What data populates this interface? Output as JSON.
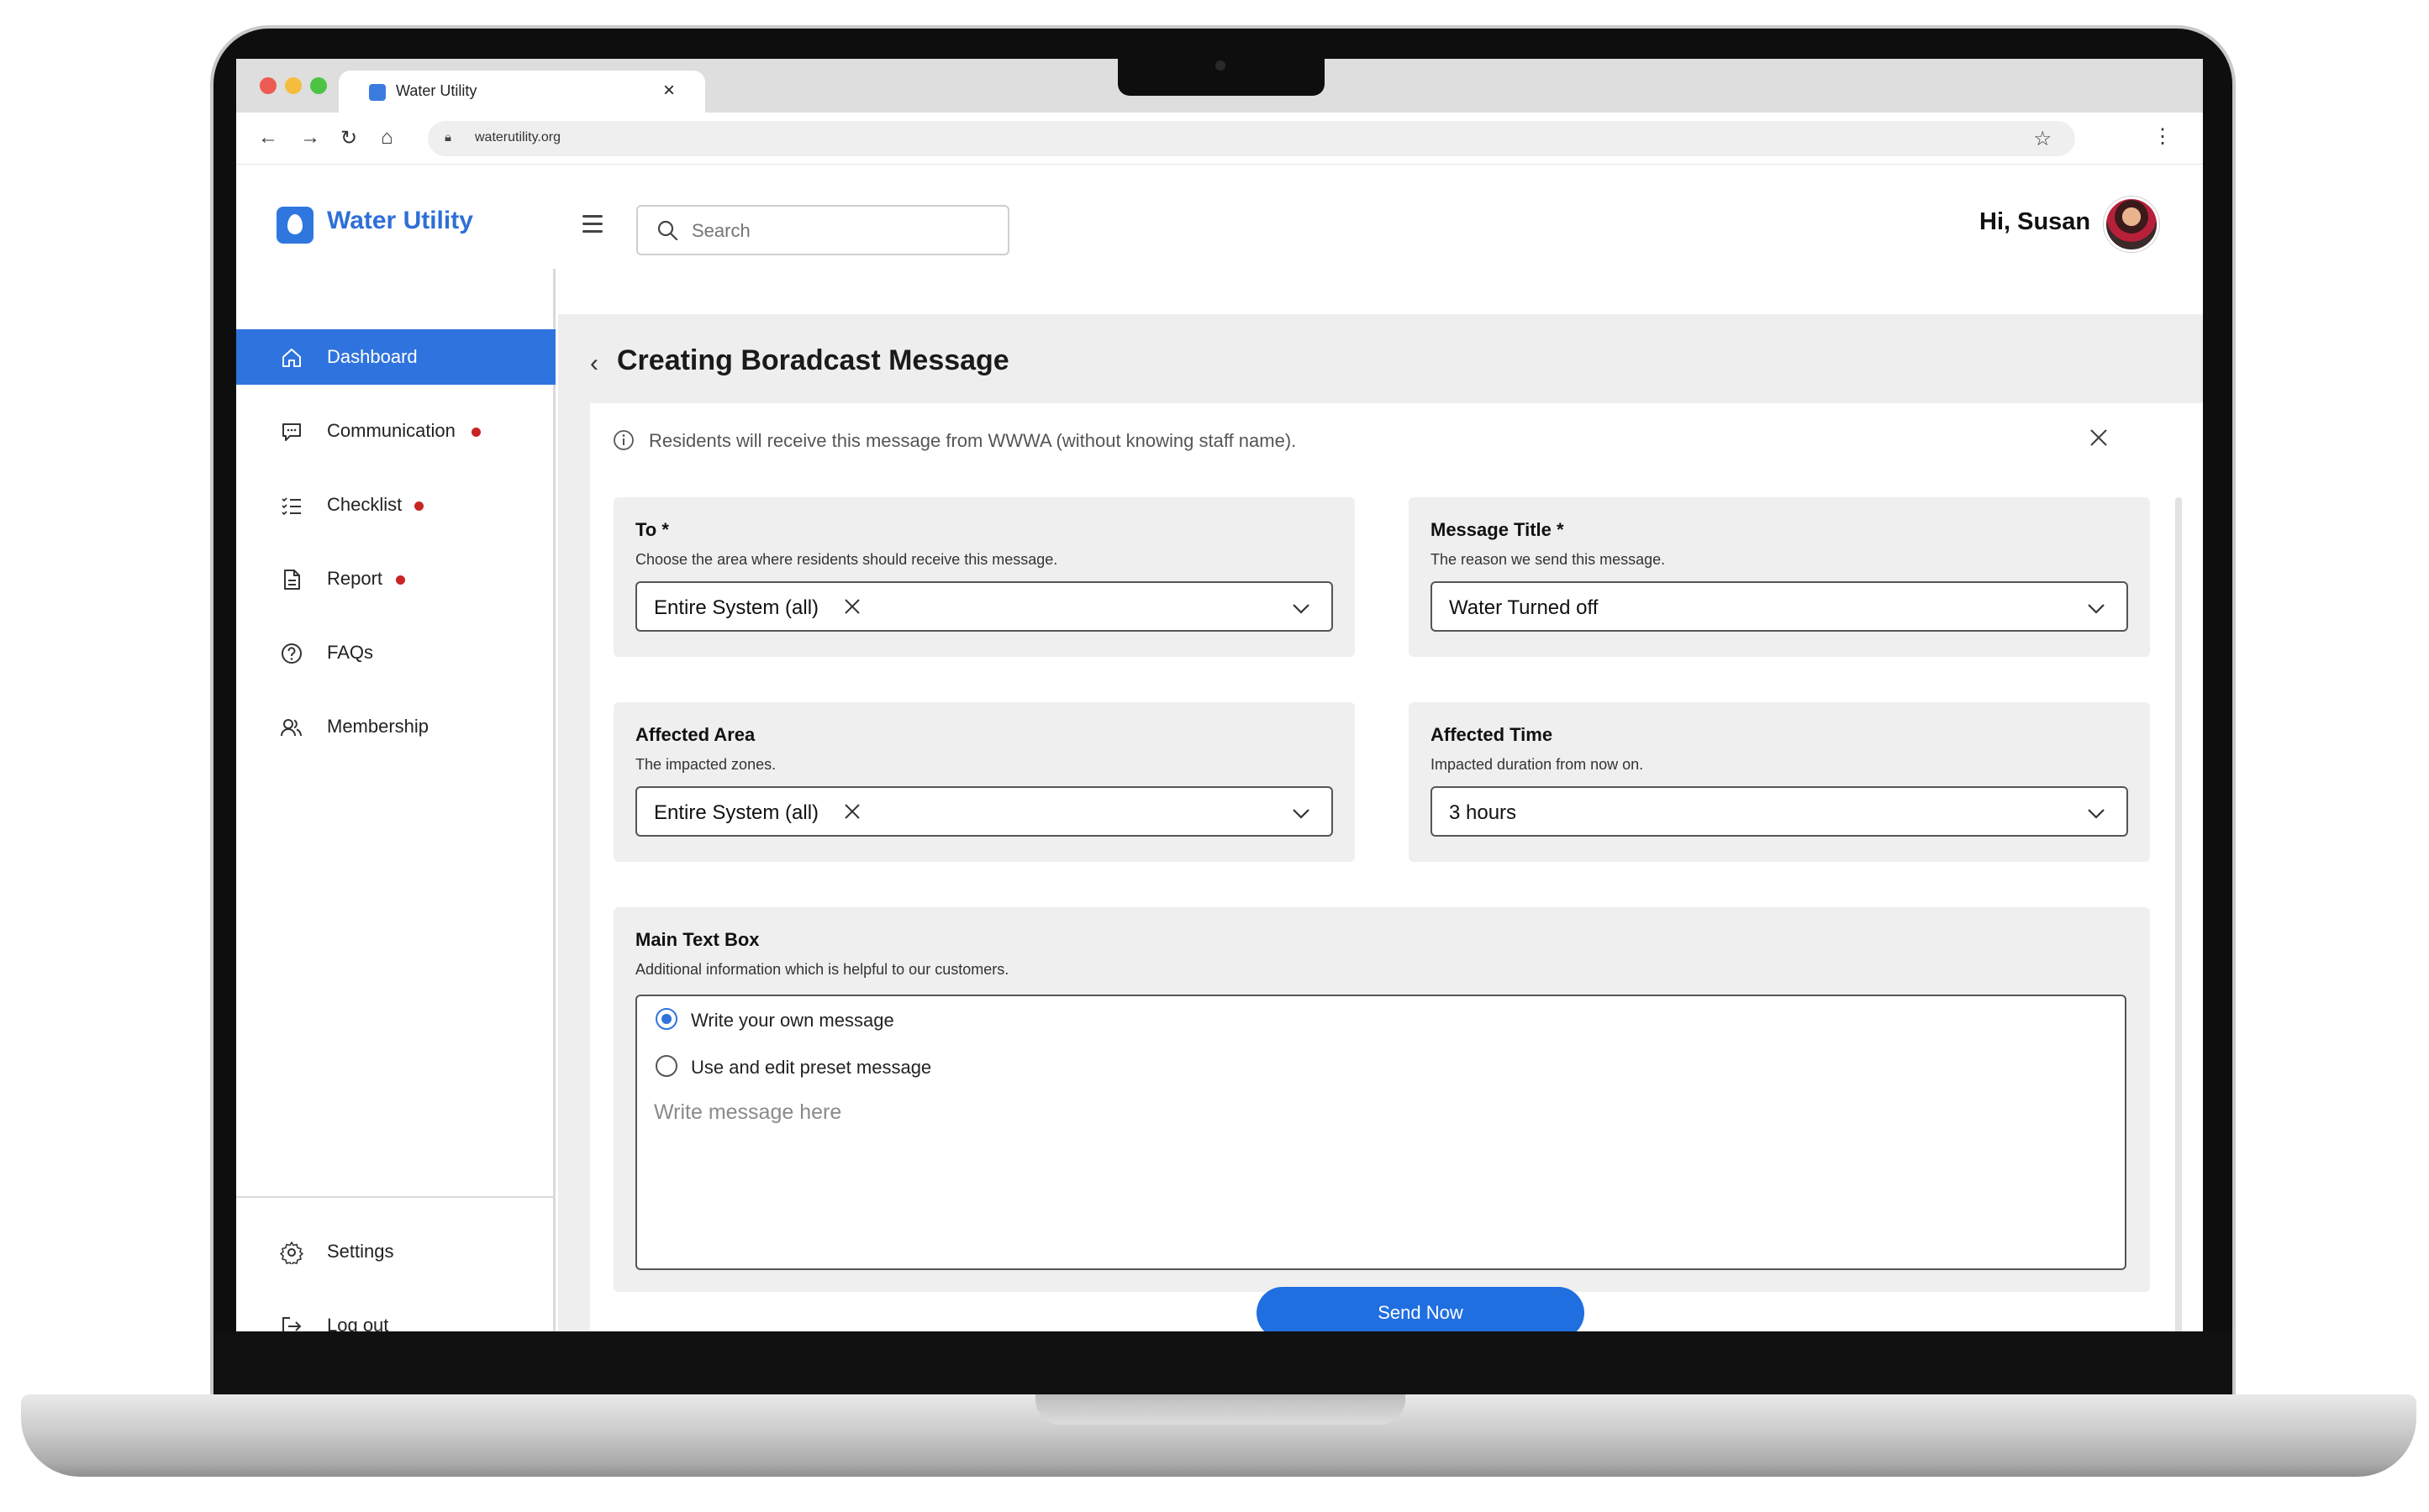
{
  "browser": {
    "tab_title": "Water Utility",
    "url": "waterutility.org"
  },
  "app": {
    "brand": "Water Utility",
    "search_placeholder": "Search",
    "greeting": "Hi, Susan"
  },
  "sidebar": {
    "items": [
      {
        "label": "Dashboard",
        "icon": "home-icon",
        "active": true,
        "badge": false
      },
      {
        "label": "Communication",
        "icon": "chat-icon",
        "active": false,
        "badge": true
      },
      {
        "label": "Checklist",
        "icon": "checklist-icon",
        "active": false,
        "badge": true
      },
      {
        "label": "Report",
        "icon": "document-icon",
        "active": false,
        "badge": true
      },
      {
        "label": "FAQs",
        "icon": "help-icon",
        "active": false,
        "badge": false
      },
      {
        "label": "Membership",
        "icon": "users-icon",
        "active": false,
        "badge": false
      }
    ],
    "bottom_items": [
      {
        "label": "Settings",
        "icon": "gear-icon"
      },
      {
        "label": "Log out",
        "icon": "logout-icon"
      }
    ]
  },
  "page": {
    "title": "Creating Boradcast Message",
    "info": "Residents will receive this message from WWWA (without knowing staff name)."
  },
  "form": {
    "to": {
      "title": "To *",
      "sub": "Choose the area where residents should receive this message.",
      "value": "Entire System (all)"
    },
    "message_title": {
      "title": "Message Title *",
      "sub": "The reason we send this message.",
      "value": "Water Turned off"
    },
    "affected_area": {
      "title": "Affected Area",
      "sub": "The impacted zones.",
      "value": "Entire System (all)"
    },
    "affected_time": {
      "title": "Affected Time",
      "sub": "Impacted duration from now on.",
      "value": "3 hours"
    },
    "main_text": {
      "title": "Main Text Box",
      "sub": "Additional information which is helpful to our customers.",
      "option_own": "Write your own message",
      "option_preset": "Use and edit preset message",
      "selected": "option_own",
      "placeholder": "Write message here"
    },
    "send_label": "Send Now"
  },
  "colors": {
    "accent": "#2f73de",
    "badge": "#c92424",
    "content_bg": "#eeeeee"
  }
}
